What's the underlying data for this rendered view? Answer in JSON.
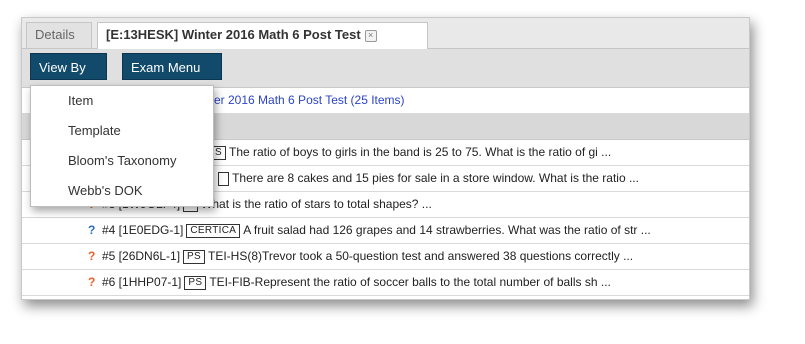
{
  "tabs": {
    "details": "Details",
    "active": "[E:13HESK] Winter 2016 Math 6 Post Test",
    "close_glyph": "×"
  },
  "toolbar": {
    "view_by": "View By",
    "exam_menu": "Exam Menu"
  },
  "view_by_menu": [
    "Item",
    "Template",
    "Bloom's Taxonomy",
    "Webb's DOK"
  ],
  "list_header": "nter 2016 Math 6 Post Test (25 Items)",
  "items": [
    {
      "icon": "?",
      "icon_color": "orange",
      "num": "",
      "tag": "S",
      "text": "The ratio of boys to girls in the band is 25 to 75. What is the ratio of gi ..."
    },
    {
      "icon": "?",
      "icon_color": "orange",
      "num": "",
      "tag": "",
      "text": "There are 8 cakes and 15 pies for sale in a store window. What is the ratio ..."
    },
    {
      "icon": "?",
      "icon_color": "orange",
      "num": "#3 [1W9OLF4]",
      "tag": "S",
      "text": "What is the ratio of stars to total shapes? ..."
    },
    {
      "icon": "?",
      "icon_color": "blue",
      "num": "#4 [1E0EDG-1]",
      "tag": "CERTICA",
      "text": "A fruit salad had 126 grapes and 14 strawberries. What was the ratio of str ..."
    },
    {
      "icon": "?",
      "icon_color": "orange",
      "num": "#5 [26DN6L-1]",
      "tag": "PS",
      "text": "TEI-HS(8)Trevor took a 50-question test and answered 38 questions correctly ..."
    },
    {
      "icon": "?",
      "icon_color": "orange",
      "num": "#6 [1HHP07-1]",
      "tag": "PS",
      "text": "TEI-FIB-Represent the ratio of soccer balls to the total number of balls sh ..."
    }
  ],
  "colors": {
    "button_bg": "#114a6b",
    "link_blue": "#2b44c9",
    "q_orange": "#e8622a",
    "q_blue": "#2a6ebb"
  }
}
